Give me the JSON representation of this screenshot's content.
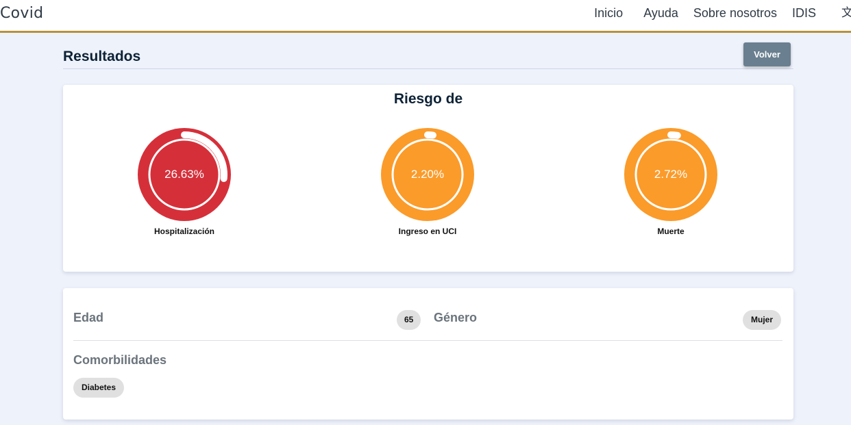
{
  "header": {
    "brand": "Covid",
    "nav": [
      "Inicio",
      "Ayuda",
      "Sobre nosotros",
      "IDIS"
    ],
    "language_icon": "translate-icon",
    "language_glyph": "文"
  },
  "page": {
    "title": "Resultados",
    "back_label": "Volver"
  },
  "risk": {
    "heading": "Riesgo de",
    "gauges": [
      {
        "label": "Hospitalización",
        "value_text": "26.63%",
        "value": 26.63,
        "color": "#d5303a"
      },
      {
        "label": "Ingreso en UCI",
        "value_text": "2.20%",
        "value": 2.2,
        "color": "#fb9b2a"
      },
      {
        "label": "Muerte",
        "value_text": "2.72%",
        "value": 2.72,
        "color": "#fb9b2a"
      }
    ]
  },
  "profile": {
    "age_label": "Edad",
    "age_value": "65",
    "gender_label": "Género",
    "gender_value": "Mujer",
    "comorbidities_label": "Comorbilidades",
    "comorbidities": [
      "Diabetes"
    ]
  }
}
